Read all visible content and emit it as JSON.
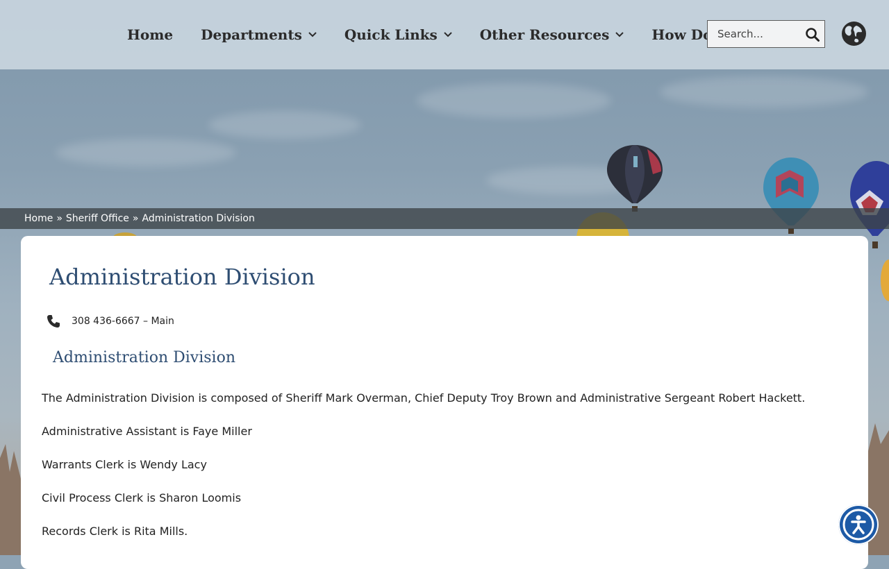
{
  "nav": {
    "items": [
      {
        "label": "Home",
        "has_dropdown": false
      },
      {
        "label": "Departments",
        "has_dropdown": true
      },
      {
        "label": "Quick Links",
        "has_dropdown": true
      },
      {
        "label": "Other Resources",
        "has_dropdown": true
      },
      {
        "label": "How Do I",
        "has_dropdown": true
      }
    ]
  },
  "search": {
    "placeholder": "Search...",
    "icon": "search-icon"
  },
  "language": {
    "icon": "globe-icon"
  },
  "breadcrumb": {
    "items": [
      "Home",
      "Sheriff Office",
      "Administration Division"
    ],
    "separator": "»"
  },
  "page": {
    "title": "Administration Division",
    "phone": {
      "icon": "phone-icon",
      "text": "308 436-6667 – Main"
    },
    "subtitle": "Administration Division",
    "paragraphs": [
      "The Administration Division is composed of Sheriff Mark Overman, Chief Deputy Troy Brown and Administrative Sergeant Robert Hackett.",
      "Administrative Assistant is Faye Miller",
      "Warrants Clerk is Wendy Lacy",
      "Civil Process Clerk is Sharon Loomis",
      "Records Clerk is Rita Mills."
    ]
  },
  "accessibility": {
    "icon": "accessibility-icon"
  },
  "colors": {
    "heading": "#2e4d72",
    "accessibility_button": "#1d5aa6"
  }
}
